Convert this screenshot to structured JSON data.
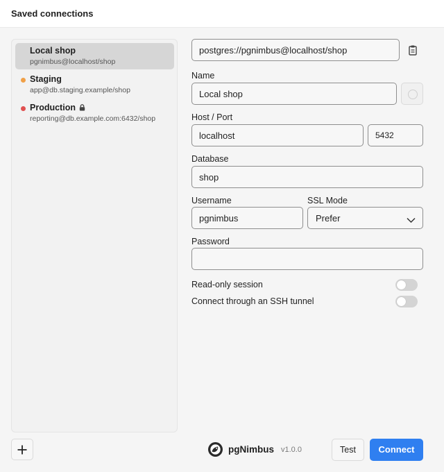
{
  "window": {
    "title": "Saved connections"
  },
  "connections": [
    {
      "name": "Local shop",
      "subtitle": "pgnimbus@localhost/shop",
      "color": "",
      "locked": false,
      "active": true
    },
    {
      "name": "Staging",
      "subtitle": "app@db.staging.example/shop",
      "color": "#f0a048",
      "locked": false,
      "active": false
    },
    {
      "name": "Production",
      "subtitle": "reporting@db.example.com:6432/shop",
      "color": "#e05050",
      "locked": true,
      "active": false
    }
  ],
  "form": {
    "url": "postgres://pgnimbus@localhost/shop",
    "name_label": "Name",
    "name_value": "Local shop",
    "host_port_label": "Host / Port",
    "host_value": "localhost",
    "port_value": "5432",
    "database_label": "Database",
    "database_value": "shop",
    "username_label": "Username",
    "username_value": "pgnimbus",
    "ssl_label": "SSL Mode",
    "ssl_value": "Prefer",
    "password_label": "Password",
    "password_value": "",
    "readonly_label": "Read-only session",
    "readonly_enabled": false,
    "ssh_label": "Connect through an SSH tunnel",
    "ssh_enabled": false
  },
  "footer": {
    "brand": "pgNimbus",
    "version": "v1.0.0",
    "test_label": "Test",
    "connect_label": "Connect"
  },
  "icons": {
    "add": "plus-icon",
    "clipboard": "clipboard-icon",
    "lock": "lock-icon",
    "chevron": "chevron-down-icon",
    "logo": "pgnimbus-logo"
  },
  "colors": {
    "accent": "#2f7ff0"
  }
}
